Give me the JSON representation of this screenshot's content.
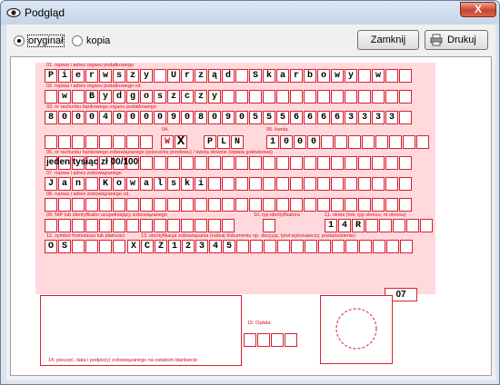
{
  "window": {
    "title": "Podgląd",
    "close_glyph": "X"
  },
  "controls": {
    "radio_original": "oryginał",
    "radio_copy": "kopia",
    "close_button": "Zamknij",
    "print_button": "Drukuj"
  },
  "form": {
    "l01": "01. nazwa i adres organu podatkowego",
    "row01": "Pierwszy Urząd Skarbowy w",
    "row01b": " w Bydgoszczy",
    "l02": "02. nazwa i adres organu podatkowego cd.",
    "l03": "03. nr rachunku bankowego organu podatkowego",
    "row03": "80004000090809055566663333 0",
    "l04": "04.",
    "l05": "05. kwota",
    "w_mark": "W",
    "x_mark": "X",
    "currency": "PLN",
    "amount": "1000",
    "l06": "06. nr rachunku bankowego zobowiązanego (polecenie przelewu) / kwota słownie (wpłata gotówkowa)",
    "amount_words": "jeden tysiąc zł 00/100",
    "l07": "07. nazwa i adres zobowiązanego",
    "row07": "Jan Kowalski",
    "l08": "08. nazwa i adres zobowiązanego cd.",
    "l09": "09. NIP lub identyfikator uzupełniający zobowiązanego",
    "l10": "10. typ identyfikatora",
    "l11": "11. okres (rok, typ okresu, nr okresu)",
    "row11": "14R",
    "l12": "12. symbol formularza lub płatności",
    "l13": "13. identyfikacja zobowiązania (rodzaj dokumentu np. decyzja, tytuł wykonawczy, postanowienie)",
    "symbol": "OS",
    "ident": "XCZ12345",
    "doc_number": "07",
    "l14": "14. pieczęć, data i podpis(y) zobowiązanego na ostatnim blankiecie",
    "l15": "15. Opłata:"
  }
}
